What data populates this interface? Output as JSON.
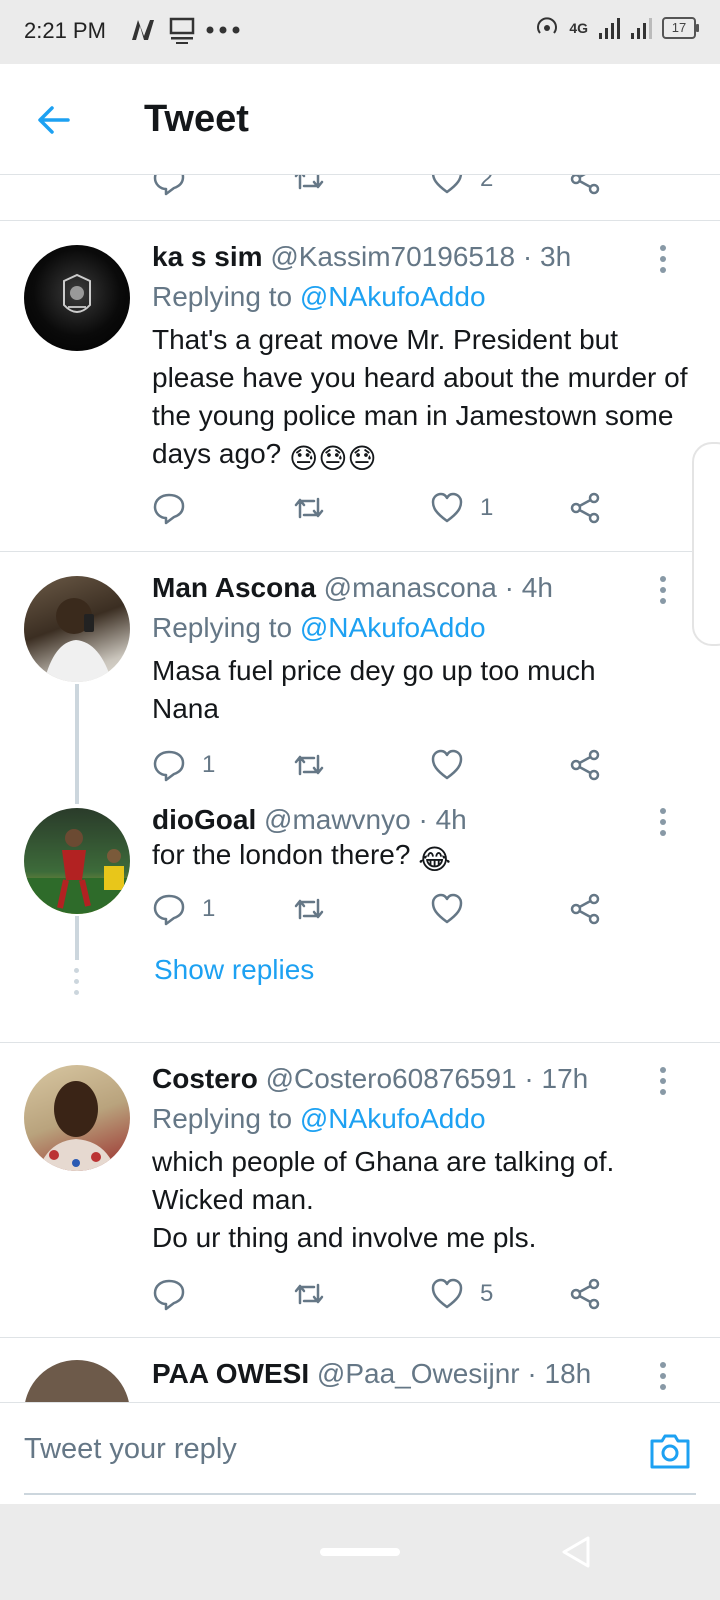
{
  "status_bar": {
    "time": "2:21 PM",
    "network": "4G",
    "battery": "17"
  },
  "header": {
    "title": "Tweet"
  },
  "top_action_row": {
    "like_count": "2"
  },
  "tweets": [
    {
      "name": "ka s sim",
      "handle": "@Kassim70196518",
      "time": "3h",
      "replying_prefix": "Replying to",
      "replying_to": "@NAkufoAddo",
      "text": "That's a great move Mr. President but please have you heard about the murder of the young police man in Jamestown some days ago?",
      "emoji": "😓😓😓",
      "reply_count": "",
      "like_count": "1"
    },
    {
      "name": "Man Ascona",
      "handle": "@manascona",
      "time": "4h",
      "replying_prefix": "Replying to",
      "replying_to": "@NAkufoAddo",
      "text": "Masa fuel price dey go up too much Nana",
      "reply_count": "1",
      "like_count": ""
    },
    {
      "name": "dioGoal",
      "handle": "@mawvnyo",
      "time": "4h",
      "text": "for the london there?",
      "emoji": "😂",
      "reply_count": "1",
      "like_count": "",
      "show_replies": "Show replies"
    },
    {
      "name": "Costero",
      "handle": "@Costero60876591",
      "time": "17h",
      "replying_prefix": "Replying to",
      "replying_to": "@NAkufoAddo",
      "text_lines": [
        "which people of Ghana are talking of.",
        "Wicked man.",
        "Do ur thing and involve me pls."
      ],
      "reply_count": "",
      "like_count": "5"
    },
    {
      "name": "PAA OWESI",
      "handle": "@Paa_Owesijnr",
      "time": "18h"
    }
  ],
  "composer": {
    "placeholder": "Tweet your reply"
  },
  "colors": {
    "accent": "#1da1f2",
    "secondary_text": "#657786",
    "divider": "#dfe3e6"
  }
}
